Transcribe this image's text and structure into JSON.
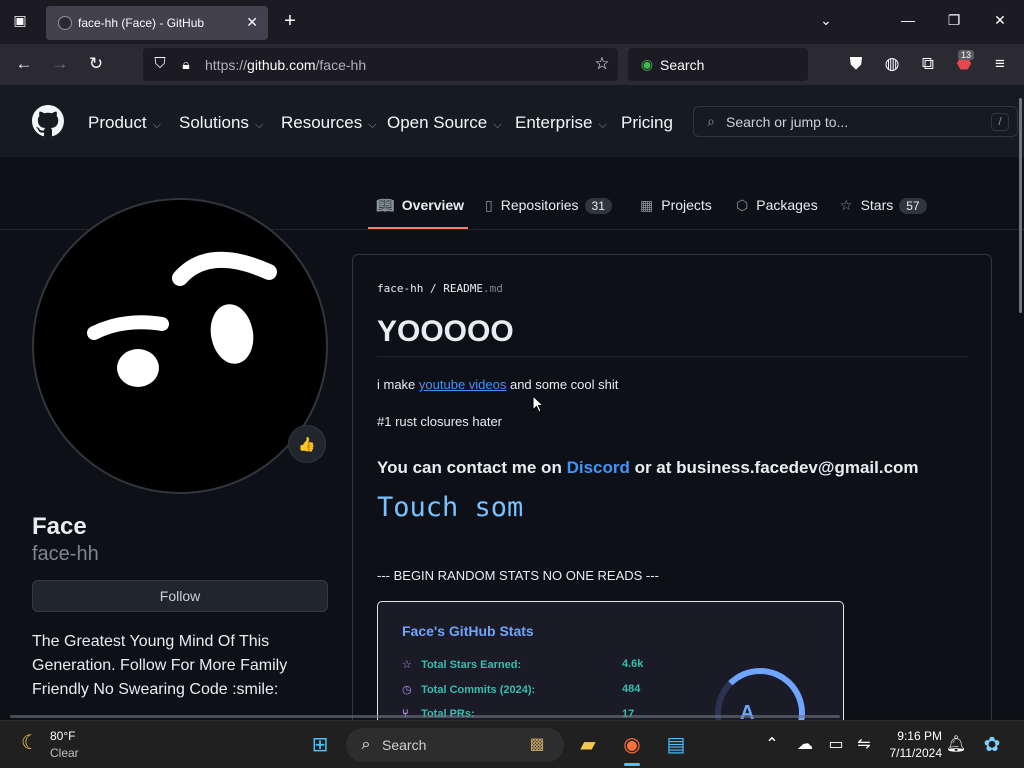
{
  "browser": {
    "tab_title": "face-hh (Face) - GitHub",
    "url_prefix": "https://",
    "url_host": "github.com",
    "url_path": "/face-hh",
    "search_placeholder": "Search",
    "extension_badge": "13"
  },
  "gh_header": {
    "nav": [
      "Product",
      "Solutions",
      "Resources",
      "Open Source",
      "Enterprise",
      "Pricing"
    ],
    "search_placeholder": "Search or jump to...",
    "search_shortcut": "/"
  },
  "profile_tabs": {
    "overview": "Overview",
    "repositories": "Repositories",
    "repositories_count": "31",
    "projects": "Projects",
    "packages": "Packages",
    "stars": "Stars",
    "stars_count": "57"
  },
  "profile": {
    "name": "Face",
    "login": "face-hh",
    "follow_label": "Follow",
    "status_emoji": "👍",
    "bio": "The Greatest Young Mind Of This Generation. Follow For More Family Friendly No Swearing Code :smile:"
  },
  "readme": {
    "path_user": "face-hh",
    "path_sep": "/",
    "path_file": "README",
    "path_ext": ".md",
    "heading": "YOOOOO",
    "line1_pre": "i make ",
    "line1_link": "youtube videos",
    "line1_post": " and some cool shit",
    "line2": "#1 rust closures hater",
    "contact_pre": "You can contact me on ",
    "contact_link": "Discord",
    "contact_post": " or at business.facedev@gmail.com",
    "mono_line": "Touch som",
    "stats_intro": "--- BEGIN RANDOM STATS NO ONE READS ---"
  },
  "stats_card": {
    "title": "Face's GitHub Stats",
    "rows": [
      {
        "label": "Total Stars Earned:",
        "value": "4.6k"
      },
      {
        "label": "Total Commits (2024):",
        "value": "484"
      },
      {
        "label": "Total PRs:",
        "value": "17"
      }
    ],
    "rank": "A",
    "colors": {
      "title": "#70a5fd",
      "text": "#38bdae",
      "icon": "#bf91f3",
      "bg": "#1a1b27"
    }
  },
  "taskbar": {
    "weather_temp": "80°F",
    "weather_cond": "Clear",
    "search_label": "Search",
    "time": "9:16 PM",
    "date": "7/11/2024"
  }
}
